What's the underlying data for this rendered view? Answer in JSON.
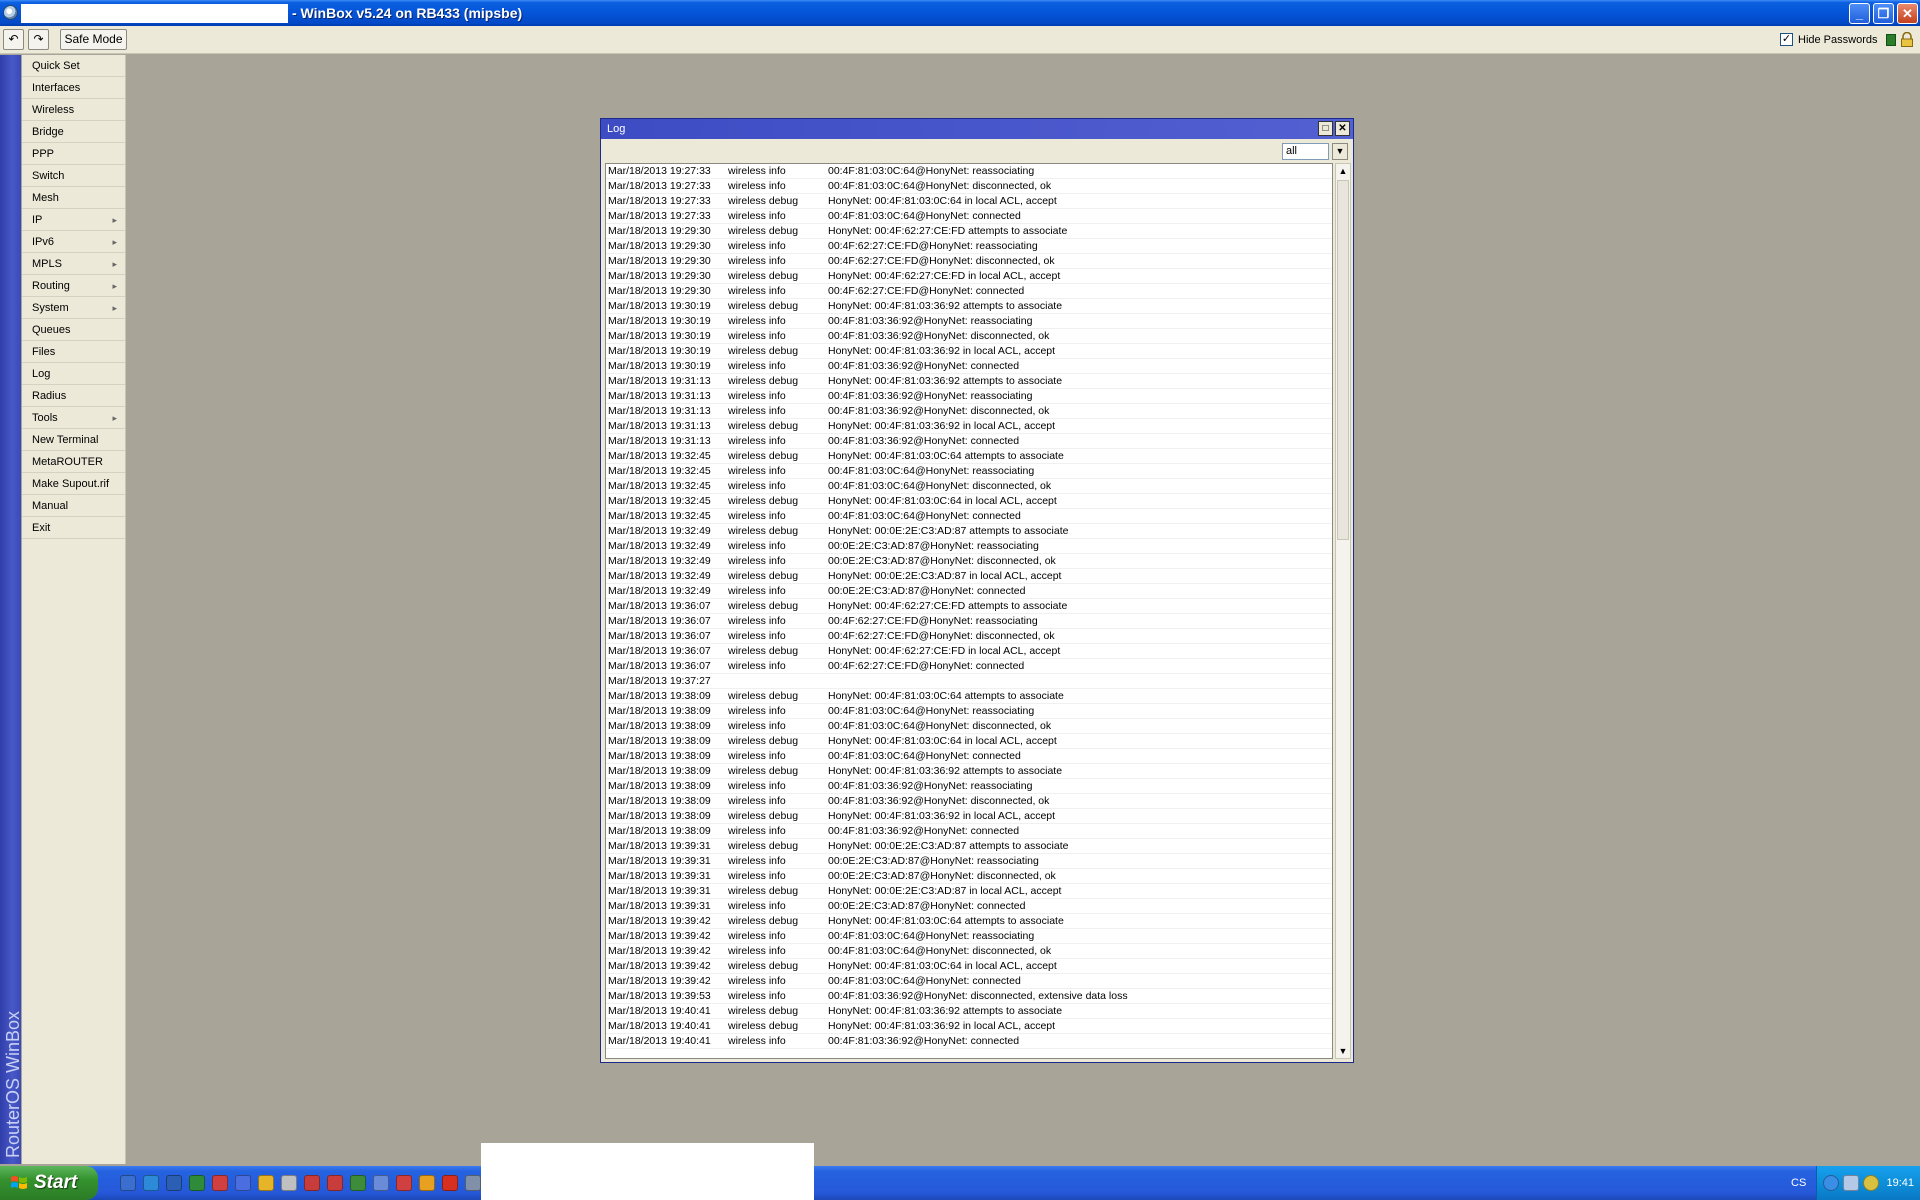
{
  "window": {
    "title": "- WinBox v5.24 on RB433 (mipsbe)"
  },
  "toolbar": {
    "undo_icon": "undo-icon",
    "redo_icon": "redo-icon",
    "safe_mode_label": "Safe Mode",
    "hide_passwords_checked": true,
    "hide_passwords_label": "Hide Passwords"
  },
  "brand": {
    "vertical_text": "RouterOS WinBox"
  },
  "sidebar": {
    "items": [
      {
        "label": "Quick Set",
        "submenu": false
      },
      {
        "label": "Interfaces",
        "submenu": false
      },
      {
        "label": "Wireless",
        "submenu": false
      },
      {
        "label": "Bridge",
        "submenu": false
      },
      {
        "label": "PPP",
        "submenu": false
      },
      {
        "label": "Switch",
        "submenu": false
      },
      {
        "label": "Mesh",
        "submenu": false
      },
      {
        "label": "IP",
        "submenu": true
      },
      {
        "label": "IPv6",
        "submenu": true
      },
      {
        "label": "MPLS",
        "submenu": true
      },
      {
        "label": "Routing",
        "submenu": true
      },
      {
        "label": "System",
        "submenu": true
      },
      {
        "label": "Queues",
        "submenu": false
      },
      {
        "label": "Files",
        "submenu": false
      },
      {
        "label": "Log",
        "submenu": false
      },
      {
        "label": "Radius",
        "submenu": false
      },
      {
        "label": "Tools",
        "submenu": true
      },
      {
        "label": "New Terminal",
        "submenu": false
      },
      {
        "label": "MetaROUTER",
        "submenu": false
      },
      {
        "label": "Make Supout.rif",
        "submenu": false
      },
      {
        "label": "Manual",
        "submenu": false
      },
      {
        "label": "Exit",
        "submenu": false
      }
    ]
  },
  "log": {
    "title": "Log",
    "filter_value": "all",
    "rows": [
      {
        "time": "Mar/18/2013 19:27:33",
        "topics": "wireless info",
        "message": "00:4F:81:03:0C:64@HonyNet: reassociating"
      },
      {
        "time": "Mar/18/2013 19:27:33",
        "topics": "wireless info",
        "message": "00:4F:81:03:0C:64@HonyNet: disconnected, ok"
      },
      {
        "time": "Mar/18/2013 19:27:33",
        "topics": "wireless debug",
        "message": "HonyNet: 00:4F:81:03:0C:64 in local ACL, accept"
      },
      {
        "time": "Mar/18/2013 19:27:33",
        "topics": "wireless info",
        "message": "00:4F:81:03:0C:64@HonyNet: connected"
      },
      {
        "time": "Mar/18/2013 19:29:30",
        "topics": "wireless debug",
        "message": "HonyNet: 00:4F:62:27:CE:FD attempts to associate"
      },
      {
        "time": "Mar/18/2013 19:29:30",
        "topics": "wireless info",
        "message": "00:4F:62:27:CE:FD@HonyNet: reassociating"
      },
      {
        "time": "Mar/18/2013 19:29:30",
        "topics": "wireless info",
        "message": "00:4F:62:27:CE:FD@HonyNet: disconnected, ok"
      },
      {
        "time": "Mar/18/2013 19:29:30",
        "topics": "wireless debug",
        "message": "HonyNet: 00:4F:62:27:CE:FD in local ACL, accept"
      },
      {
        "time": "Mar/18/2013 19:29:30",
        "topics": "wireless info",
        "message": "00:4F:62:27:CE:FD@HonyNet: connected"
      },
      {
        "time": "Mar/18/2013 19:30:19",
        "topics": "wireless debug",
        "message": "HonyNet: 00:4F:81:03:36:92 attempts to associate"
      },
      {
        "time": "Mar/18/2013 19:30:19",
        "topics": "wireless info",
        "message": "00:4F:81:03:36:92@HonyNet: reassociating"
      },
      {
        "time": "Mar/18/2013 19:30:19",
        "topics": "wireless info",
        "message": "00:4F:81:03:36:92@HonyNet: disconnected, ok"
      },
      {
        "time": "Mar/18/2013 19:30:19",
        "topics": "wireless debug",
        "message": "HonyNet: 00:4F:81:03:36:92 in local ACL, accept"
      },
      {
        "time": "Mar/18/2013 19:30:19",
        "topics": "wireless info",
        "message": "00:4F:81:03:36:92@HonyNet: connected"
      },
      {
        "time": "Mar/18/2013 19:31:13",
        "topics": "wireless debug",
        "message": "HonyNet: 00:4F:81:03:36:92 attempts to associate"
      },
      {
        "time": "Mar/18/2013 19:31:13",
        "topics": "wireless info",
        "message": "00:4F:81:03:36:92@HonyNet: reassociating"
      },
      {
        "time": "Mar/18/2013 19:31:13",
        "topics": "wireless info",
        "message": "00:4F:81:03:36:92@HonyNet: disconnected, ok"
      },
      {
        "time": "Mar/18/2013 19:31:13",
        "topics": "wireless debug",
        "message": "HonyNet: 00:4F:81:03:36:92 in local ACL, accept"
      },
      {
        "time": "Mar/18/2013 19:31:13",
        "topics": "wireless info",
        "message": "00:4F:81:03:36:92@HonyNet: connected"
      },
      {
        "time": "Mar/18/2013 19:32:45",
        "topics": "wireless debug",
        "message": "HonyNet: 00:4F:81:03:0C:64 attempts to associate"
      },
      {
        "time": "Mar/18/2013 19:32:45",
        "topics": "wireless info",
        "message": "00:4F:81:03:0C:64@HonyNet: reassociating"
      },
      {
        "time": "Mar/18/2013 19:32:45",
        "topics": "wireless info",
        "message": "00:4F:81:03:0C:64@HonyNet: disconnected, ok"
      },
      {
        "time": "Mar/18/2013 19:32:45",
        "topics": "wireless debug",
        "message": "HonyNet: 00:4F:81:03:0C:64 in local ACL, accept"
      },
      {
        "time": "Mar/18/2013 19:32:45",
        "topics": "wireless info",
        "message": "00:4F:81:03:0C:64@HonyNet: connected"
      },
      {
        "time": "Mar/18/2013 19:32:49",
        "topics": "wireless debug",
        "message": "HonyNet: 00:0E:2E:C3:AD:87 attempts to associate"
      },
      {
        "time": "Mar/18/2013 19:32:49",
        "topics": "wireless info",
        "message": "00:0E:2E:C3:AD:87@HonyNet: reassociating"
      },
      {
        "time": "Mar/18/2013 19:32:49",
        "topics": "wireless info",
        "message": "00:0E:2E:C3:AD:87@HonyNet: disconnected, ok"
      },
      {
        "time": "Mar/18/2013 19:32:49",
        "topics": "wireless debug",
        "message": "HonyNet: 00:0E:2E:C3:AD:87 in local ACL, accept"
      },
      {
        "time": "Mar/18/2013 19:32:49",
        "topics": "wireless info",
        "message": "00:0E:2E:C3:AD:87@HonyNet: connected"
      },
      {
        "time": "Mar/18/2013 19:36:07",
        "topics": "wireless debug",
        "message": "HonyNet: 00:4F:62:27:CE:FD attempts to associate"
      },
      {
        "time": "Mar/18/2013 19:36:07",
        "topics": "wireless info",
        "message": "00:4F:62:27:CE:FD@HonyNet: reassociating"
      },
      {
        "time": "Mar/18/2013 19:36:07",
        "topics": "wireless info",
        "message": "00:4F:62:27:CE:FD@HonyNet: disconnected, ok"
      },
      {
        "time": "Mar/18/2013 19:36:07",
        "topics": "wireless debug",
        "message": "HonyNet: 00:4F:62:27:CE:FD in local ACL, accept"
      },
      {
        "time": "Mar/18/2013 19:36:07",
        "topics": "wireless info",
        "message": "00:4F:62:27:CE:FD@HonyNet: connected"
      },
      {
        "time": "Mar/18/2013 19:37:27",
        "topics": "",
        "message": ""
      },
      {
        "time": "Mar/18/2013 19:38:09",
        "topics": "wireless debug",
        "message": "HonyNet: 00:4F:81:03:0C:64 attempts to associate"
      },
      {
        "time": "Mar/18/2013 19:38:09",
        "topics": "wireless info",
        "message": "00:4F:81:03:0C:64@HonyNet: reassociating"
      },
      {
        "time": "Mar/18/2013 19:38:09",
        "topics": "wireless info",
        "message": "00:4F:81:03:0C:64@HonyNet: disconnected, ok"
      },
      {
        "time": "Mar/18/2013 19:38:09",
        "topics": "wireless debug",
        "message": "HonyNet: 00:4F:81:03:0C:64 in local ACL, accept"
      },
      {
        "time": "Mar/18/2013 19:38:09",
        "topics": "wireless info",
        "message": "00:4F:81:03:0C:64@HonyNet: connected"
      },
      {
        "time": "Mar/18/2013 19:38:09",
        "topics": "wireless debug",
        "message": "HonyNet: 00:4F:81:03:36:92 attempts to associate"
      },
      {
        "time": "Mar/18/2013 19:38:09",
        "topics": "wireless info",
        "message": "00:4F:81:03:36:92@HonyNet: reassociating"
      },
      {
        "time": "Mar/18/2013 19:38:09",
        "topics": "wireless info",
        "message": "00:4F:81:03:36:92@HonyNet: disconnected, ok"
      },
      {
        "time": "Mar/18/2013 19:38:09",
        "topics": "wireless debug",
        "message": "HonyNet: 00:4F:81:03:36:92 in local ACL, accept"
      },
      {
        "time": "Mar/18/2013 19:38:09",
        "topics": "wireless info",
        "message": "00:4F:81:03:36:92@HonyNet: connected"
      },
      {
        "time": "Mar/18/2013 19:39:31",
        "topics": "wireless debug",
        "message": "HonyNet: 00:0E:2E:C3:AD:87 attempts to associate"
      },
      {
        "time": "Mar/18/2013 19:39:31",
        "topics": "wireless info",
        "message": "00:0E:2E:C3:AD:87@HonyNet: reassociating"
      },
      {
        "time": "Mar/18/2013 19:39:31",
        "topics": "wireless info",
        "message": "00:0E:2E:C3:AD:87@HonyNet: disconnected, ok"
      },
      {
        "time": "Mar/18/2013 19:39:31",
        "topics": "wireless debug",
        "message": "HonyNet: 00:0E:2E:C3:AD:87 in local ACL, accept"
      },
      {
        "time": "Mar/18/2013 19:39:31",
        "topics": "wireless info",
        "message": "00:0E:2E:C3:AD:87@HonyNet: connected"
      },
      {
        "time": "Mar/18/2013 19:39:42",
        "topics": "wireless debug",
        "message": "HonyNet: 00:4F:81:03:0C:64 attempts to associate"
      },
      {
        "time": "Mar/18/2013 19:39:42",
        "topics": "wireless info",
        "message": "00:4F:81:03:0C:64@HonyNet: reassociating"
      },
      {
        "time": "Mar/18/2013 19:39:42",
        "topics": "wireless info",
        "message": "00:4F:81:03:0C:64@HonyNet: disconnected, ok"
      },
      {
        "time": "Mar/18/2013 19:39:42",
        "topics": "wireless debug",
        "message": "HonyNet: 00:4F:81:03:0C:64 in local ACL, accept"
      },
      {
        "time": "Mar/18/2013 19:39:42",
        "topics": "wireless info",
        "message": "00:4F:81:03:0C:64@HonyNet: connected"
      },
      {
        "time": "Mar/18/2013 19:39:53",
        "topics": "wireless info",
        "message": "00:4F:81:03:36:92@HonyNet: disconnected, extensive data loss"
      },
      {
        "time": "Mar/18/2013 19:40:41",
        "topics": "wireless debug",
        "message": "HonyNet: 00:4F:81:03:36:92 attempts to associate"
      },
      {
        "time": "Mar/18/2013 19:40:41",
        "topics": "wireless debug",
        "message": "HonyNet: 00:4F:81:03:36:92 in local ACL, accept"
      },
      {
        "time": "Mar/18/2013 19:40:41",
        "topics": "wireless info",
        "message": "00:4F:81:03:36:92@HonyNet: connected"
      }
    ]
  },
  "taskbar": {
    "start_label": "Start",
    "language": "CS",
    "clock": "19:41",
    "quick_launch": [
      "app-icon",
      "ie-icon",
      "word-icon",
      "excel-icon",
      "paint-icon",
      "app-icon",
      "app-icon",
      "app-icon",
      "app-icon",
      "app-icon",
      "app-icon",
      "app-icon",
      "app-icon",
      "chrome-icon",
      "opera-icon",
      "winbox-icon"
    ]
  }
}
